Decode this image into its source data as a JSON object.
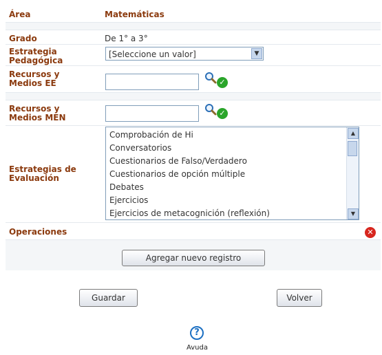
{
  "form": {
    "area": {
      "label": "Área",
      "value": "Matemáticas"
    },
    "grado": {
      "label": "Grado",
      "value": "De 1° a 3°"
    },
    "estrategia_pedagogica": {
      "label_line1": "Estrategia",
      "label_line2": "Pedagógica",
      "selected": "[Seleccione un valor]"
    },
    "recursos_ee": {
      "label_line1": "Recursos y",
      "label_line2": "Medios EE",
      "value": ""
    },
    "recursos_men": {
      "label_line1": "Recursos y",
      "label_line2": "Medios MEN",
      "value": ""
    },
    "estrategias_evaluacion": {
      "label_line1": "Estrategias de",
      "label_line2": "Evaluación",
      "options": [
        "Comprobación de Hi",
        "Conversatorios",
        "Cuestionarios de Falso/Verdadero",
        "Cuestionarios de opción múltiple",
        "Debates",
        "Ejercicios",
        "Ejercicios de metacognición (reflexión)"
      ]
    },
    "operaciones": {
      "label": "Operaciones"
    },
    "add_button": "Agregar nuevo registro"
  },
  "actions": {
    "save": "Guardar",
    "back": "Volver"
  },
  "help": {
    "label": "Avuda"
  },
  "icons": {
    "search": "magnifier-icon",
    "validate": "check-icon",
    "delete": "delete-icon",
    "help": "help-icon"
  },
  "colors": {
    "label": "#8b3a0e",
    "ok": "#2aa52a",
    "error": "#d7261e",
    "help": "#1b6fc2"
  }
}
